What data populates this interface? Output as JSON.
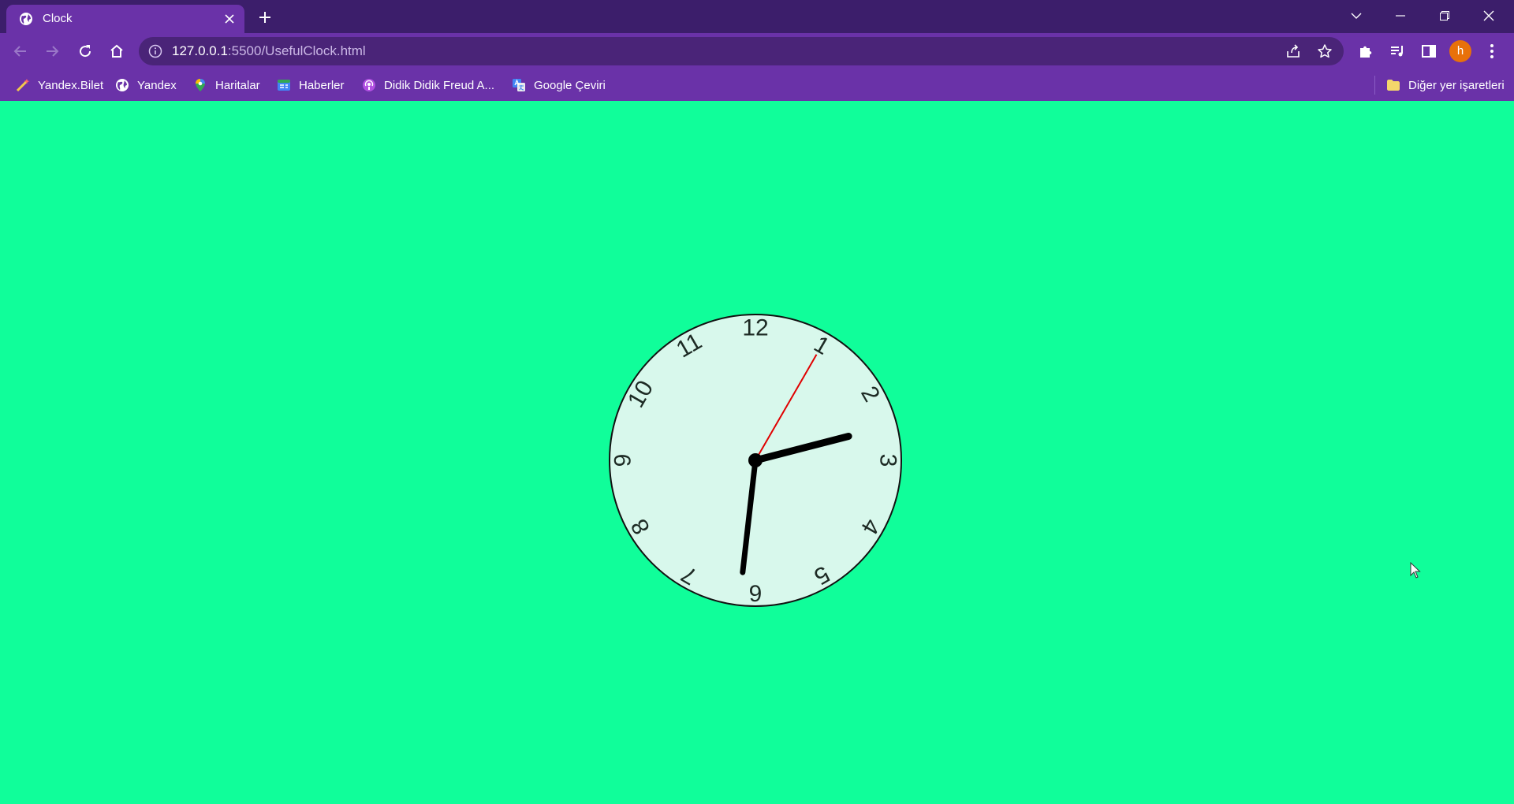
{
  "browser": {
    "tab": {
      "title": "Clock",
      "favicon": "globe-icon"
    },
    "url": {
      "host": "127.0.0.1",
      "path": ":5500/UsefulClock.html"
    },
    "avatar_letter": "h",
    "bookmarks": [
      {
        "label": "Yandex.Bilet",
        "icon": "wand-icon"
      },
      {
        "label": "Yandex",
        "icon": "globe-icon"
      },
      {
        "label": "Haritalar",
        "icon": "maps-pin-icon"
      },
      {
        "label": "Haberler",
        "icon": "news-icon"
      },
      {
        "label": "Didik Didik Freud A...",
        "icon": "podcast-icon"
      },
      {
        "label": "Google Çeviri",
        "icon": "translate-icon"
      }
    ],
    "other_bookmarks": {
      "label": "Diğer yer işaretleri",
      "icon": "folder-icon"
    }
  },
  "clock": {
    "numerals": [
      "12",
      "1",
      "2",
      "3",
      "4",
      "5",
      "6",
      "7",
      "8",
      "9",
      "10",
      "11"
    ],
    "time": {
      "hour": 2,
      "minute": 31,
      "second": 5
    },
    "colors": {
      "page_background": "#10fe9a",
      "face": "#d8f8ec",
      "hands": "#000000",
      "second_hand": "#e00000"
    }
  }
}
